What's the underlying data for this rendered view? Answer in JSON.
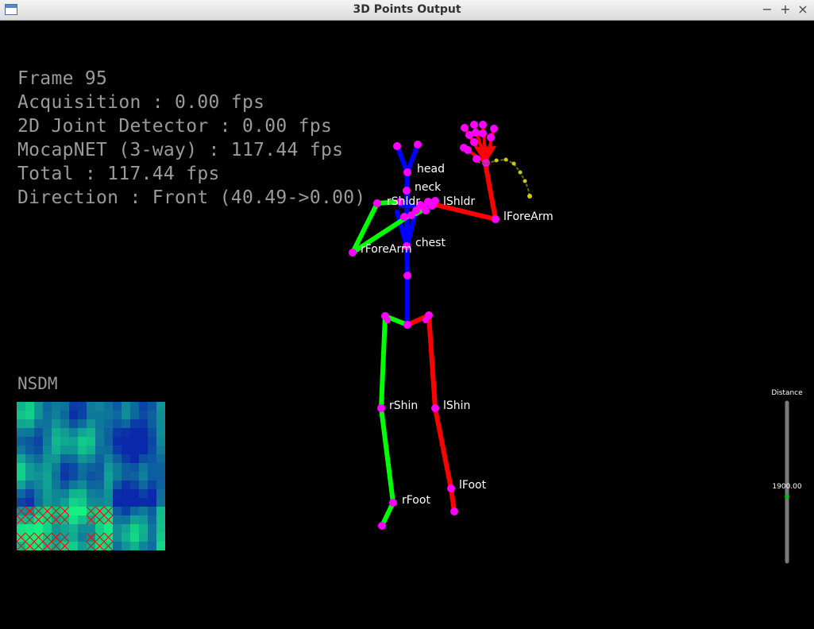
{
  "window": {
    "title": "3D Points Output",
    "buttons": {
      "minimize": "−",
      "maximize": "+",
      "close": "×"
    }
  },
  "stats": [
    "Frame 95",
    "Acquisition : 0.00 fps",
    "2D Joint Detector : 0.00 fps",
    "MocapNET (3-way) : 117.44 fps",
    "Total : 117.44 fps",
    "Direction : Front (40.49->0.00)"
  ],
  "nsdm": {
    "label": "NSDM"
  },
  "joint_labels": {
    "head": "head",
    "neck": "neck",
    "rShldr": "rShldr",
    "lShldr": "lShldr",
    "chest": "chest",
    "rForeArm": "rForeArm",
    "lForeArm": "lForeArm",
    "rShin": "rShin",
    "lShin": "lShin",
    "rFoot": "rFoot",
    "lFoot": "lFoot"
  },
  "distance_slider": {
    "label": "Distance",
    "value": "1900.00"
  },
  "colors": {
    "spine": "#0000ff",
    "right_side": "#00ff00",
    "left_side": "#ff0000",
    "joint": "#ff00ff",
    "stats_text": "#9a9a9a"
  }
}
